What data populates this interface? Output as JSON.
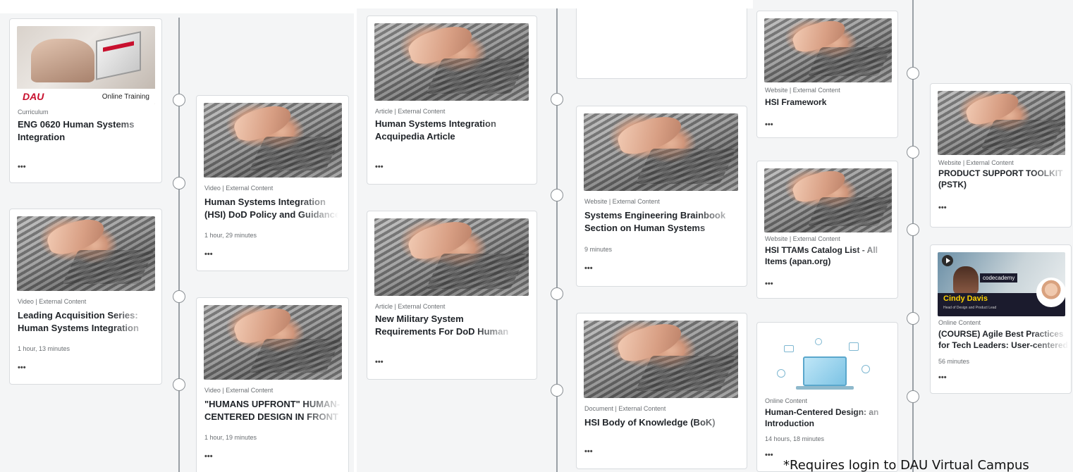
{
  "cards": [
    {
      "meta": "Curriculum",
      "title1": "ENG 0620 Human Systems",
      "title2": "Integration",
      "duration": "",
      "more": "•••",
      "dau_logo": "DAU",
      "dau_tag": "Online Training"
    },
    {
      "meta": "Video | External Content",
      "title1": "Human Systems Integration",
      "title2": "(HSI) DoD Policy and Guidance",
      "duration": "1 hour, 29 minutes",
      "more": "•••"
    },
    {
      "meta": "Video | External Content",
      "title1": "Leading Acquisition Series:",
      "title2": "Human Systems Integration",
      "duration": "1 hour, 13 minutes",
      "more": "•••"
    },
    {
      "meta": "Video | External Content",
      "title1": "\"HUMANS UPFRONT\" HUMAN-",
      "title2": "CENTERED DESIGN IN FRONT",
      "duration": "1 hour, 19 minutes",
      "more": "•••"
    },
    {
      "meta": "Article | External Content",
      "title1": "Human Systems Integration",
      "title2": "Acquipedia Article",
      "duration": "",
      "more": "•••"
    },
    {
      "meta": "Article | External Content",
      "title1": "New Military System",
      "title2": "Requirements For DoD Human",
      "duration": "",
      "more": "•••"
    },
    {
      "meta": "Website | External Content",
      "title1": "Systems Engineering Brainbook",
      "title2": "Section on Human Systems",
      "duration": "9 minutes",
      "more": "•••"
    },
    {
      "meta": "Document | External Content",
      "title1": "HSI Body of Knowledge (BoK)",
      "title2": "",
      "duration": "",
      "more": "•••"
    },
    {
      "meta": "Website | External Content",
      "title1": "HSI Framework",
      "title2": "",
      "duration": "",
      "more": "•••"
    },
    {
      "meta": "Website | External Content",
      "title1": "HSI TTAMs Catalog List - All",
      "title2": "Items (apan.org)",
      "duration": "",
      "more": "•••"
    },
    {
      "meta": "Online Content",
      "title1": "Human-Centered Design: an",
      "title2": "Introduction",
      "duration": "14 hours, 18 minutes",
      "more": "•••"
    },
    {
      "meta": "Website | External Content",
      "title1": "PRODUCT SUPPORT TOOLKIT",
      "title2": "(PSTK)",
      "duration": "",
      "more": "•••"
    },
    {
      "meta": "Online Content",
      "title1": "(COURSE) Agile Best Practices",
      "title2": "for Tech Leaders: User-centered",
      "duration": "56 minutes",
      "more": "•••",
      "cc_brand": "codecademy",
      "cc_name": "Cindy Davis",
      "cc_sub": "Head of Design and Product Lead"
    }
  ],
  "footnote": "*Requires login to DAU Virtual Campus",
  "colors": {
    "panel": "#f4f5f6",
    "line": "#9aa0a6",
    "dau_red": "#c8102e"
  }
}
